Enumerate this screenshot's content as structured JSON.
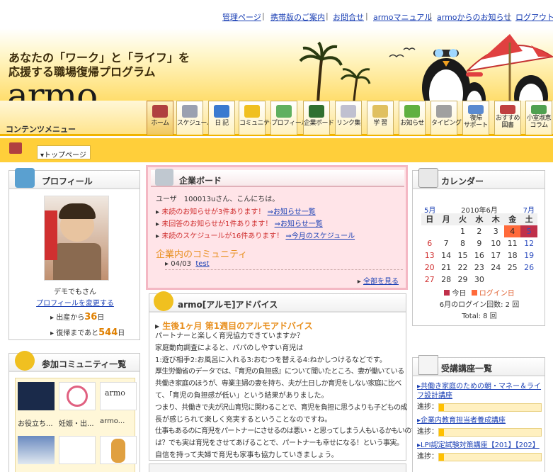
{
  "top_links": [
    "管理ページ",
    "携帯版のご案内",
    "お問合せ",
    "armoマニュアル",
    "armoからのお知らせ",
    "ログアウト"
  ],
  "header": {
    "tagline_line1": "あなたの「ワーク」と「ライフ」を",
    "tagline_line2": "応援する職場復帰プログラム",
    "logo": "armo"
  },
  "nav": {
    "menu_label": "コンテンツメニュー",
    "items": [
      {
        "label": "ホーム"
      },
      {
        "label": "スケジュール"
      },
      {
        "label": "日 記"
      },
      {
        "label": "コミュニティ"
      },
      {
        "label": "プロフィール"
      },
      {
        "label": "企業ボード"
      },
      {
        "label": "リンク集"
      },
      {
        "label": "学 習"
      },
      {
        "label": "お知らせ"
      },
      {
        "label": "タイピング"
      },
      {
        "label1": "復帰",
        "label2": "サポート"
      },
      {
        "label1": "おすすめ",
        "label2": "図書"
      },
      {
        "label1": "小室淑恵",
        "label2": "コラム"
      }
    ]
  },
  "breadcrumb": "トップページ",
  "profile": {
    "title": "プロフィール",
    "name": "デモでもさん",
    "edit_link": "プロフィールを変更する",
    "since_prefix": "出産から",
    "since_days": "36",
    "since_suffix": "日",
    "return_prefix": "復帰まであと",
    "return_days": "544",
    "return_suffix": "日"
  },
  "community": {
    "title": "参加コミュニティ一覧",
    "items": [
      "お役立ち...",
      "妊娠・出...",
      "armo...",
      "",
      "",
      ""
    ],
    "armo_logo": "armo"
  },
  "board": {
    "title": "企業ボード",
    "greeting": "ユーザ　100013uさん、こんにちは。",
    "notices": [
      {
        "text": "未読のお知らせが3件あります！",
        "link": "⇒お知らせ一覧"
      },
      {
        "text": "未回答のお知らせが1件あります！",
        "link": "⇒お知らせ一覧"
      },
      {
        "text": "未読のスケジュールが16件あります！",
        "link": "⇒今月のスケジュール"
      }
    ],
    "community_heading": "企業内のコミュニティ",
    "community_items": [
      {
        "date": "04/03",
        "title": "test"
      }
    ],
    "see_all": "全部を見る"
  },
  "advice": {
    "title": "armo[アルモ]アドバイス",
    "heading": "生後1ヶ月 第1週目のアルモアドバイス",
    "lines": [
      "パートナーと楽しく育児協力できていますか？",
      "家庭動向調査によると、パパのしやすい育児は",
      "1:遊び相手2:お風呂に入れる3:おむつを替える4:ねかしつけるなどです。",
      "厚生労働省のデータでは、『育児の負担感』について聞いたところ、妻が働いている",
      "共働き家庭のほうが、専業主婦の妻を持ち、夫が土日しか育児をしない家庭に比べ",
      "て、「育児の負担感が低い」という結果がありました。",
      "つまり、共働きで夫が沢山育児に関わることで、育児を負担に思うよりも子どもの成",
      "長が感じられて楽しく充実するということなのですね。",
      "仕事もあるのに育児をパートナーにさせるのは悪い・と思ってしまう人もいるかもいので",
      "は？でも実は育児をさせてあげることで、パートナーも幸せになる！という事実。",
      "自信を持って夫婦で育児も家事も協力していきましょう。"
    ]
  },
  "calendar": {
    "title": "カレンダー",
    "prev": "5月",
    "current": "2010年6月",
    "next": "7月",
    "weekdays": [
      "日",
      "月",
      "火",
      "水",
      "木",
      "金",
      "土"
    ],
    "weeks": [
      [
        "",
        "",
        "1",
        "2",
        "3",
        "4",
        "5"
      ],
      [
        "6",
        "7",
        "8",
        "9",
        "10",
        "11",
        "12"
      ],
      [
        "13",
        "14",
        "15",
        "16",
        "17",
        "18",
        "19"
      ],
      [
        "20",
        "21",
        "22",
        "23",
        "24",
        "25",
        "26"
      ],
      [
        "27",
        "28",
        "29",
        "30",
        "",
        "",
        ""
      ]
    ],
    "today": "4",
    "login_day": "5",
    "legend_today": "今日",
    "legend_login": "ログイン日",
    "login_count_label": "6月のログイン回数: 2 回",
    "total_label": "Total: 8 回",
    "colors": {
      "today": "#ff6a3a",
      "login": "#c0304a",
      "sunday": "#d03030",
      "saturday": "#3050c0"
    }
  },
  "courses": {
    "title": "受講講座一覧",
    "progress_label": "進捗：",
    "items": [
      {
        "name": "共働き家庭のための朝・マネー＆ライフ設計講座",
        "progress": 0.05
      },
      {
        "name": "企業内教育担当者養成講座",
        "progress": 0.05
      },
      {
        "name": "LPI認定試験対策講座【201】【202】",
        "progress": 0.05
      }
    ]
  }
}
